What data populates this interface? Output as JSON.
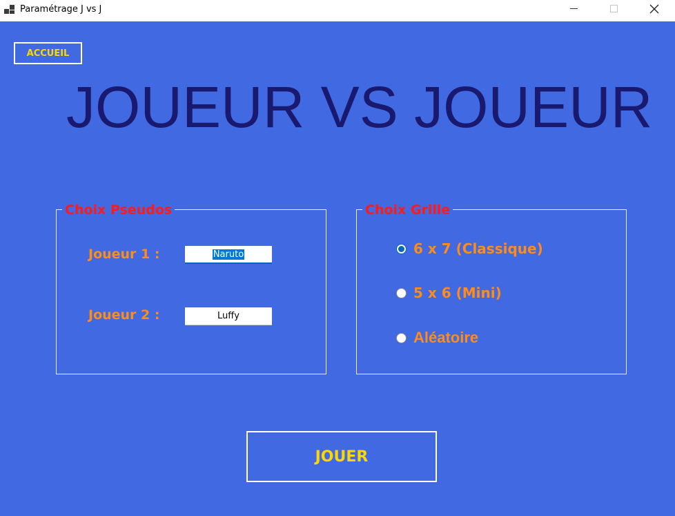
{
  "window": {
    "title": "Paramétrage J vs J",
    "icons": {
      "app": "app-icon",
      "minimize": "minimize-icon",
      "maximize": "maximize-icon",
      "close": "close-icon"
    },
    "close_glyph": "✕"
  },
  "colors": {
    "background": "#4169e1",
    "title": "#191970",
    "legend": "#ff1a1a",
    "label": "#ff8c1a",
    "button_text": "#ffd700",
    "selection": "#0078d7"
  },
  "nav": {
    "accueil_label": "ACCUEIL"
  },
  "main": {
    "title": "JOUEUR VS JOUEUR"
  },
  "pseudos": {
    "legend": "Choix Pseudos",
    "player1_label": "Joueur 1 :",
    "player1_value": "Naruto",
    "player2_label": "Joueur 2 :",
    "player2_value": "Luffy"
  },
  "grille": {
    "legend": "Choix Grille",
    "options": [
      {
        "label": "6 x 7 (Classique)",
        "selected": true
      },
      {
        "label": "5 x 6 (Mini)",
        "selected": false
      },
      {
        "label": "Aléatoire",
        "selected": false
      }
    ]
  },
  "actions": {
    "play_label": "JOUER"
  }
}
